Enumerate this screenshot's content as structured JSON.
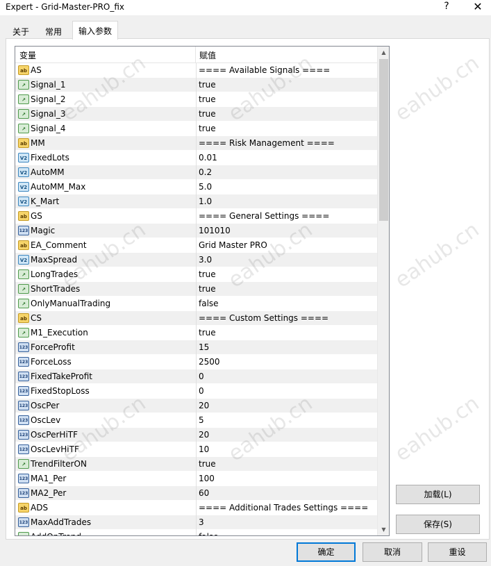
{
  "window": {
    "title": "Expert - Grid-Master-PRO_fix",
    "help": "?",
    "close": "✕"
  },
  "tabs": [
    {
      "label": "关于",
      "active": false
    },
    {
      "label": "常用",
      "active": false
    },
    {
      "label": "输入参数",
      "active": true
    }
  ],
  "grid": {
    "headers": {
      "variable": "变量",
      "value": "赋值"
    },
    "rows": [
      {
        "type": "ab",
        "name": "AS",
        "value": "==== Available Signals ===="
      },
      {
        "type": "bool",
        "name": "Signal_1",
        "value": "true"
      },
      {
        "type": "bool",
        "name": "Signal_2",
        "value": "true"
      },
      {
        "type": "bool",
        "name": "Signal_3",
        "value": "true"
      },
      {
        "type": "bool",
        "name": "Signal_4",
        "value": "true"
      },
      {
        "type": "ab",
        "name": "MM",
        "value": "==== Risk Management ===="
      },
      {
        "type": "dbl",
        "name": "FixedLots",
        "value": "0.01"
      },
      {
        "type": "dbl",
        "name": "AutoMM",
        "value": "0.2"
      },
      {
        "type": "dbl",
        "name": "AutoMM_Max",
        "value": "5.0"
      },
      {
        "type": "dbl",
        "name": "K_Mart",
        "value": "1.0"
      },
      {
        "type": "ab",
        "name": "GS",
        "value": "==== General Settings ===="
      },
      {
        "type": "int",
        "name": "Magic",
        "value": "101010"
      },
      {
        "type": "ab",
        "name": "EA_Comment",
        "value": "Grid Master PRO"
      },
      {
        "type": "dbl",
        "name": "MaxSpread",
        "value": "3.0"
      },
      {
        "type": "bool",
        "name": "LongTrades",
        "value": "true"
      },
      {
        "type": "bool",
        "name": "ShortTrades",
        "value": "true"
      },
      {
        "type": "bool",
        "name": "OnlyManualTrading",
        "value": "false"
      },
      {
        "type": "ab",
        "name": "CS",
        "value": "==== Custom Settings ===="
      },
      {
        "type": "bool",
        "name": "M1_Execution",
        "value": "true"
      },
      {
        "type": "int",
        "name": "ForceProfit",
        "value": "15"
      },
      {
        "type": "int",
        "name": "ForceLoss",
        "value": "2500"
      },
      {
        "type": "int",
        "name": "FixedTakeProfit",
        "value": "0"
      },
      {
        "type": "int",
        "name": "FixedStopLoss",
        "value": "0"
      },
      {
        "type": "int",
        "name": "OscPer",
        "value": "20"
      },
      {
        "type": "int",
        "name": "OscLev",
        "value": "5"
      },
      {
        "type": "int",
        "name": "OscPerHiTF",
        "value": "20"
      },
      {
        "type": "int",
        "name": "OscLevHiTF",
        "value": "10"
      },
      {
        "type": "bool",
        "name": "TrendFilterON",
        "value": "true"
      },
      {
        "type": "int",
        "name": "MA1_Per",
        "value": "100"
      },
      {
        "type": "int",
        "name": "MA2_Per",
        "value": "60"
      },
      {
        "type": "ab",
        "name": "ADS",
        "value": "==== Additional Trades Settings ===="
      },
      {
        "type": "int",
        "name": "MaxAddTrades",
        "value": "3"
      },
      {
        "type": "bool",
        "name": "AddOnTrend",
        "value": "false"
      }
    ]
  },
  "icon_glyphs": {
    "ab": "ab",
    "bool": "↗",
    "dbl": "V2",
    "int": "123"
  },
  "scrollbar": {
    "up": "▲",
    "down": "▼"
  },
  "buttons": {
    "load": "加载(L)",
    "save": "保存(S)",
    "ok": "确定",
    "cancel": "取消",
    "reset": "重设"
  },
  "watermark": "eahub.cn"
}
